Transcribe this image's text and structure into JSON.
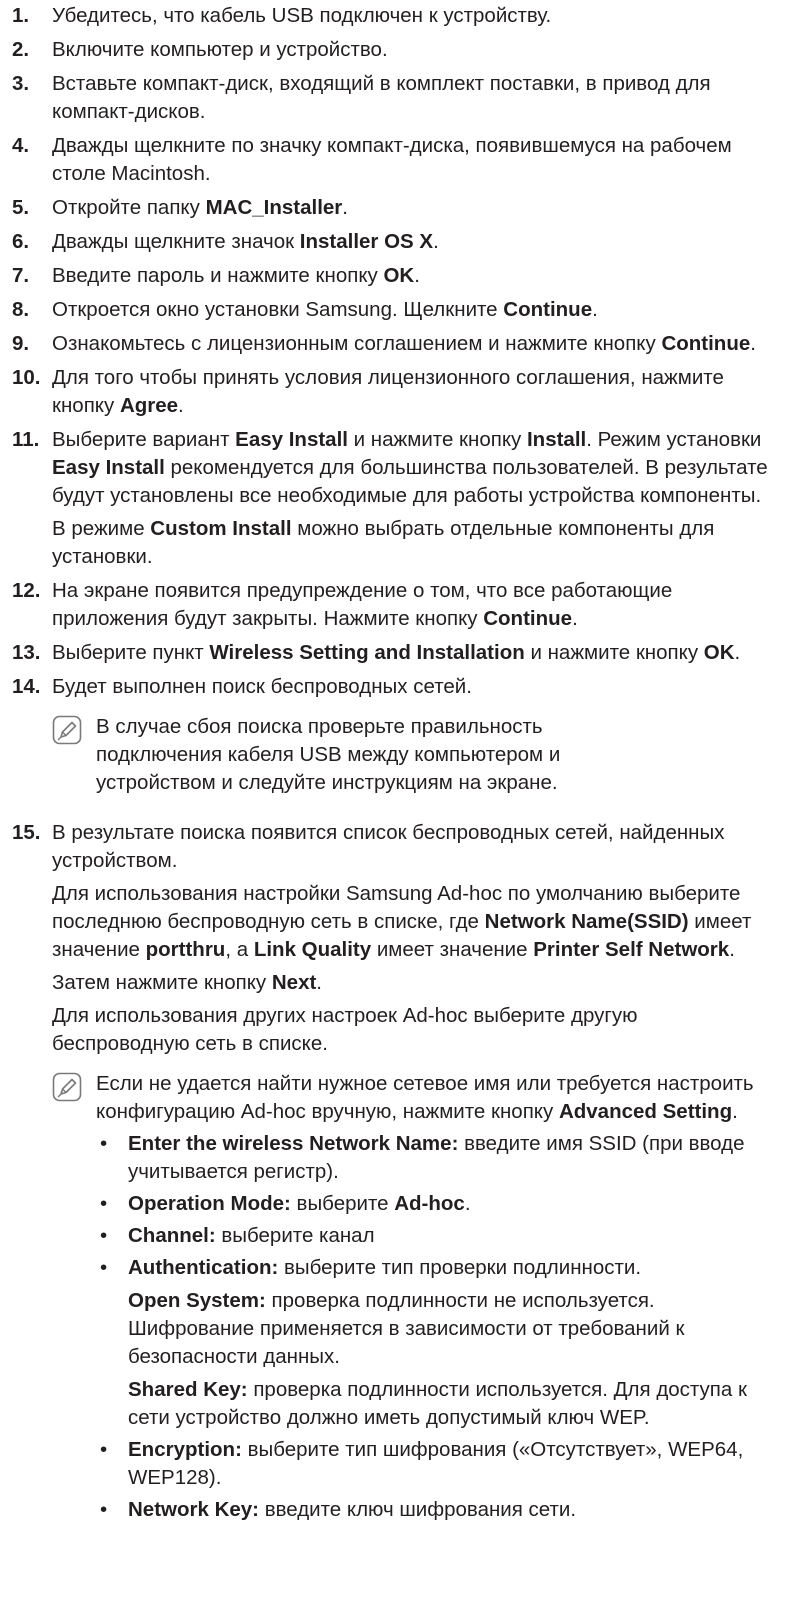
{
  "steps": [
    {
      "num": "1.",
      "text": "Убедитесь, что кабель USB подключен к устройству."
    },
    {
      "num": "2.",
      "text": "Включите компьютер и устройство."
    },
    {
      "num": "3.",
      "text": "Вставьте компакт-диск, входящий в комплект поставки, в привод для компакт-дисков."
    },
    {
      "num": "4.",
      "text": "Дважды щелкните по значку компакт-диска, появившемуся на рабочем столе Macintosh."
    },
    {
      "num": "5.",
      "a": "Откройте папку ",
      "b1": "MAC_Installer",
      "c": "."
    },
    {
      "num": "6.",
      "a": "Дважды щелкните значок ",
      "b1": "Installer OS X",
      "c": "."
    },
    {
      "num": "7.",
      "a": "Введите пароль и нажмите кнопку ",
      "b1": "OK",
      "c": "."
    },
    {
      "num": "8.",
      "a": "Откроется окно установки Samsung. Щелкните ",
      "b1": "Continue",
      "c": "."
    },
    {
      "num": "9.",
      "a": "Ознакомьтесь с лицензионным соглашением и нажмите кнопку ",
      "b1": "Continue",
      "c": "."
    },
    {
      "num": "10.",
      "a": "Для того чтобы принять условия лицензионного соглашения, нажмите кнопку ",
      "b1": "Agree",
      "c": "."
    },
    {
      "num": "11.",
      "p1": {
        "a": "Выберите вариант ",
        "b1": "Easy Install",
        "c": " и нажмите кнопку ",
        "b2": "Install",
        "d": ". Режим установки ",
        "b3": "Easy Install",
        "e": " рекомендуется для большинства пользователей. В результате будут установлены все необходимые для работы устройства компоненты."
      },
      "p2": {
        "a": "В режиме ",
        "b1": "Custom Install",
        "c": " можно выбрать отдельные компоненты для установки."
      }
    },
    {
      "num": "12.",
      "a": "На экране появится предупреждение о том, что все работающие приложения будут закрыты. Нажмите кнопку ",
      "b1": "Continue",
      "c": "."
    },
    {
      "num": "13.",
      "a": "Выберите пункт ",
      "b1": "Wireless Setting and Installation",
      "c": " и нажмите кнопку ",
      "b2": "OK",
      "d": "."
    },
    {
      "num": "14.",
      "text": "Будет выполнен поиск беспроводных сетей.",
      "note": {
        "icon": "note-pencil-icon",
        "text": "В случае сбоя поиска проверьте правильность подключения кабеля USB между компьютером и устройством и следуйте инструкциям на экране."
      }
    },
    {
      "num": "15.",
      "p1": "В результате поиска появится список беспроводных сетей, найденных устройством.",
      "p2": {
        "a": "Для использования настройки Samsung Ad-hoc по умолчанию выберите последнюю беспроводную сеть в списке, где ",
        "b1": "Network Name(SSID)",
        "c": " имеет значение ",
        "b2": "portthru",
        "d": ", а ",
        "b3": "Link Quality",
        "e": " имеет значение ",
        "b4": "Printer Self Network",
        "f": "."
      },
      "p3": {
        "a": "Затем нажмите кнопку ",
        "b1": "Next",
        "c": "."
      },
      "p4": "Для использования других настроек Ad-hoc выберите другую беспроводную сеть в списке.",
      "note": {
        "icon": "note-pencil-icon",
        "a": "Если не удается найти нужное сетевое имя или требуется настроить конфигурацию Ad-hoc вручную, нажмите кнопку ",
        "b1": "Advanced Setting",
        "c": ".",
        "bullet": "•",
        "items": [
          {
            "label": "Enter the wireless Network Name:",
            "text": " введите имя SSID (при вводе учитывается регистр)."
          },
          {
            "label": "Operation Mode:",
            "text": " выберите ",
            "value": "Ad-hoc",
            "end": "."
          },
          {
            "label": "Channel:",
            "text": " выберите канал"
          },
          {
            "label": "Authentication:",
            "text": " выберите тип проверки подлинности.",
            "subs": [
              {
                "label": "Open System:",
                "text": " проверка подлинности не используется. Шифрование применяется в зависимости от требований к безопасности данных."
              },
              {
                "label": "Shared Key:",
                "text": " проверка подлинности используется. Для доступа к сети устройство должно иметь допустимый ключ WEP."
              }
            ]
          },
          {
            "label": "Encryption:",
            "text": " выберите тип шифрования («Отсутствует», WEP64, WEP128)."
          },
          {
            "label": "Network Key:",
            "text": " введите ключ шифрования сети."
          }
        ]
      }
    }
  ]
}
